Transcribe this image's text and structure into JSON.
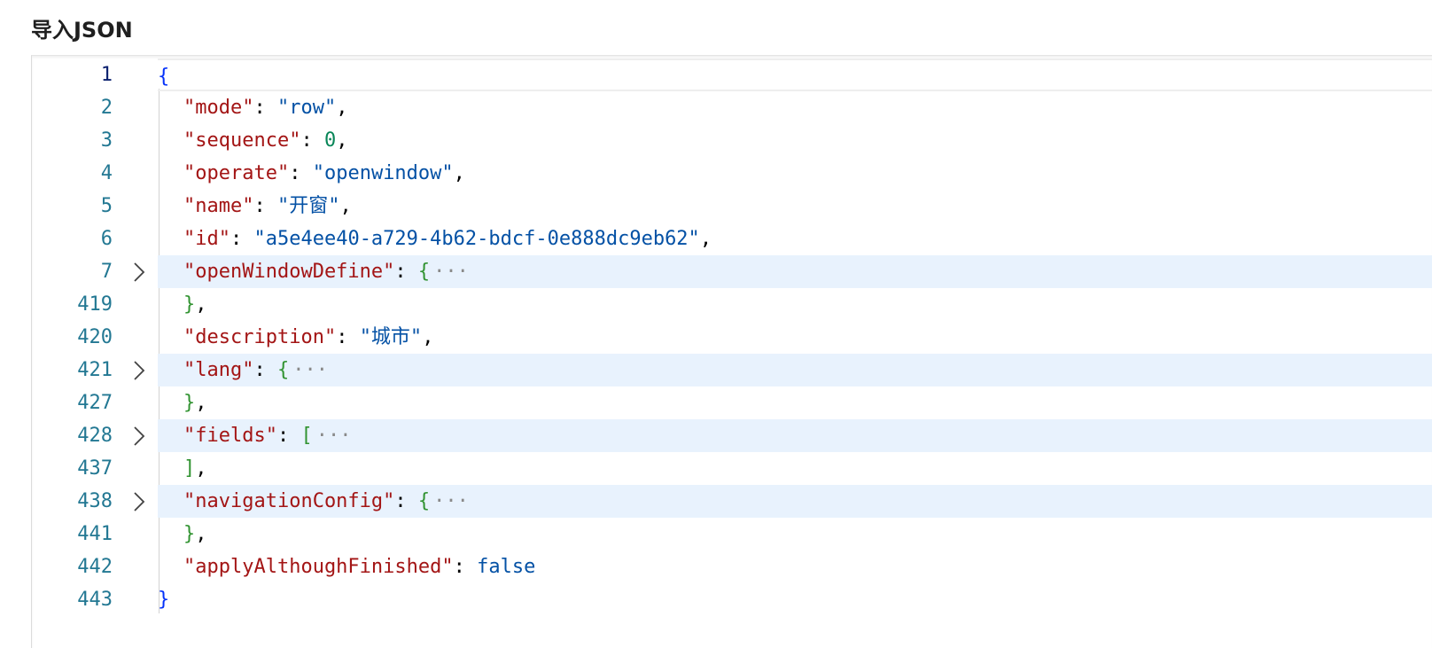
{
  "title": "导入JSON",
  "editor": {
    "lines": [
      {
        "no": "1",
        "open": "{"
      },
      {
        "no": "2",
        "key": "\"mode\"",
        "sep": ": ",
        "value": "\"row\"",
        "vtype": "str",
        "tail": ","
      },
      {
        "no": "3",
        "key": "\"sequence\"",
        "sep": ": ",
        "value": "0",
        "vtype": "num",
        "tail": ","
      },
      {
        "no": "4",
        "key": "\"operate\"",
        "sep": ": ",
        "value": "\"openwindow\"",
        "vtype": "str",
        "tail": ","
      },
      {
        "no": "5",
        "key": "\"name\"",
        "sep": ": ",
        "value": "\"开窗\"",
        "vtype": "str",
        "tail": ","
      },
      {
        "no": "6",
        "key": "\"id\"",
        "sep": ": ",
        "value": "\"a5e4ee40-a729-4b62-bdcf-0e888dc9eb62\"",
        "vtype": "str",
        "tail": ","
      },
      {
        "no": "7",
        "key": "\"openWindowDefine\"",
        "sep": ": ",
        "bracket": "{",
        "folded": true,
        "ellipsis": "···"
      },
      {
        "no": "419",
        "bracket": "}",
        "tail": ","
      },
      {
        "no": "420",
        "key": "\"description\"",
        "sep": ": ",
        "value": "\"城市\"",
        "vtype": "str",
        "tail": ","
      },
      {
        "no": "421",
        "key": "\"lang\"",
        "sep": ": ",
        "bracket": "{",
        "folded": true,
        "ellipsis": "···"
      },
      {
        "no": "427",
        "bracket": "}",
        "tail": ","
      },
      {
        "no": "428",
        "key": "\"fields\"",
        "sep": ": ",
        "bracket": "[",
        "folded": true,
        "ellipsis": "···"
      },
      {
        "no": "437",
        "bracket": "]",
        "tail": ","
      },
      {
        "no": "438",
        "key": "\"navigationConfig\"",
        "sep": ": ",
        "bracket": "{",
        "folded": true,
        "ellipsis": "···"
      },
      {
        "no": "441",
        "bracket": "}",
        "tail": ","
      },
      {
        "no": "442",
        "key": "\"applyAlthoughFinished\"",
        "sep": ": ",
        "value": "false",
        "vtype": "kw",
        "tail": ""
      },
      {
        "no": "443",
        "close": "}"
      }
    ]
  },
  "colors": {
    "line_number": "#237893",
    "key": "#a31515",
    "string": "#0451a5",
    "number": "#098658",
    "bracket_outer": "#0431fa",
    "bracket_inner": "#319331",
    "fold_highlight": "#e8f2fd"
  },
  "icons": {
    "fold": "chevron-right-icon"
  }
}
